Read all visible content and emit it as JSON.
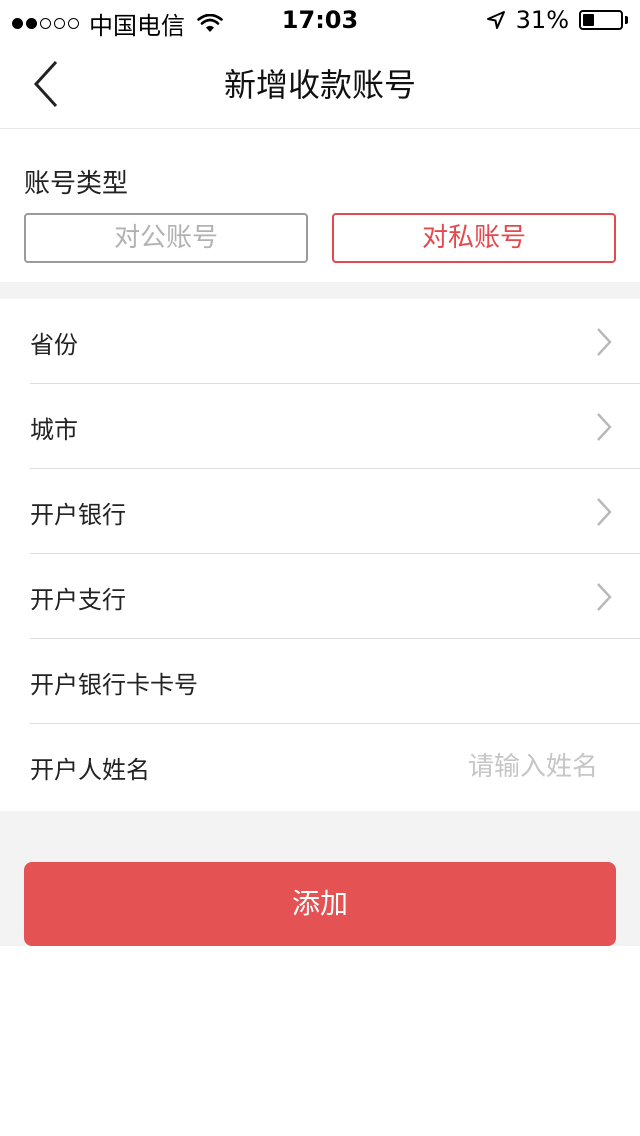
{
  "status_bar": {
    "carrier": "中国电信",
    "time": "17:03",
    "battery_percent": "31%",
    "battery_level": 0.31,
    "signal_bars_filled": 2,
    "signal_bars_total": 5
  },
  "nav": {
    "title": "新增收款账号",
    "back_icon": "chevron-left-icon"
  },
  "account_type": {
    "label": "账号类型",
    "options": [
      {
        "label": "对公账号",
        "selected": false
      },
      {
        "label": "对私账号",
        "selected": true
      }
    ]
  },
  "form": {
    "rows": [
      {
        "label": "省份",
        "type": "select"
      },
      {
        "label": "城市",
        "type": "select"
      },
      {
        "label": "开户银行",
        "type": "select"
      },
      {
        "label": "开户支行",
        "type": "select"
      },
      {
        "label": "开户银行卡卡号",
        "type": "input",
        "value": "",
        "placeholder": ""
      },
      {
        "label": "开户人姓名",
        "type": "input",
        "value": "",
        "placeholder": "请输入姓名"
      }
    ]
  },
  "actions": {
    "add_label": "添加"
  },
  "colors": {
    "accent": "#e4494e",
    "button": "#e45253",
    "gray_border": "#9a9a9a",
    "placeholder": "#c6c6c6",
    "section_gap": "#f3f3f3"
  }
}
